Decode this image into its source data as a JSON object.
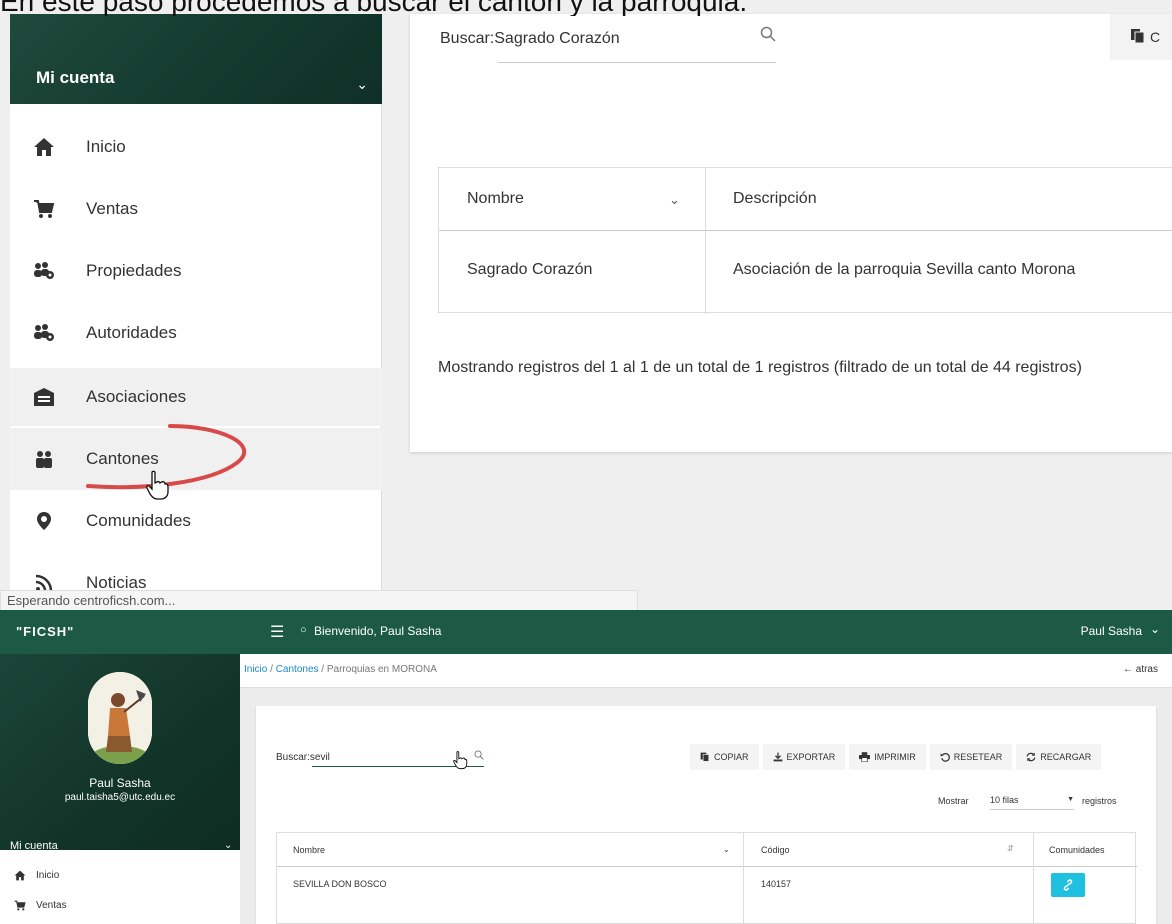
{
  "caption": "En este paso procedemos a buscar el cantón y la parroquia.",
  "zoom": {
    "sidebar": {
      "header_label": "Mi cuenta",
      "items": [
        {
          "label": "Inicio",
          "icon": "home-icon"
        },
        {
          "label": "Ventas",
          "icon": "cart-icon"
        },
        {
          "label": "Propiedades",
          "icon": "users-gear-icon"
        },
        {
          "label": "Autoridades",
          "icon": "users-gear-icon"
        },
        {
          "label": "Asociaciones",
          "icon": "warehouse-icon"
        },
        {
          "label": "Cantones",
          "icon": "map-people-icon"
        },
        {
          "label": "Comunidades",
          "icon": "map-pin-icon"
        },
        {
          "label": "Noticias",
          "icon": "rss-icon"
        }
      ]
    },
    "search_value": "Buscar:Sagrado Corazón",
    "copy_label": "C",
    "table": {
      "headers": [
        "Nombre",
        "Descripción"
      ],
      "rows": [
        [
          "Sagrado Corazón",
          "Asociación de la parroquia Sevilla canto Morona"
        ]
      ]
    },
    "info_text": "Mostrando registros del 1 al 1 de un total de 1 registros (filtrado de un total de 44 registros)",
    "status_text": "Esperando centroficsh.com..."
  },
  "app": {
    "brand": "\"FICSH\"",
    "welcome": "Bienvenido, Paul Sasha",
    "user_menu": "Paul Sasha",
    "profile": {
      "name": "Paul Sasha",
      "email": "paul.taisha5@utc.edu.ec"
    },
    "menu_label": "Mi cuenta",
    "side_items": [
      {
        "label": "Inicio",
        "icon": "home-icon"
      },
      {
        "label": "Ventas",
        "icon": "cart-icon"
      }
    ],
    "breadcrumb": {
      "home": "Inicio",
      "sep1": "/",
      "section": "Cantones",
      "sep2": "/",
      "current": "Parroquias en MORONA"
    },
    "back_label": "atras",
    "search_value": "Buscar:sevil",
    "toolbar": [
      "COPIAR",
      "EXPORTAR",
      "IMPRIMIR",
      "RESETEAR",
      "RECARGAR"
    ],
    "page_size": {
      "prefix": "Mostrar",
      "value": "10 filas",
      "suffix": "registros"
    },
    "table": {
      "headers": [
        "Nombre",
        "Código",
        "Comunidades"
      ],
      "rows": [
        [
          "SEVILLA DON BOSCO",
          "140157"
        ]
      ]
    },
    "colors": {
      "brand_green": "#1d5a46",
      "link_blue": "#1a8ac8",
      "action_cyan": "#20c0e0",
      "annotation_red": "#d84a4a"
    }
  }
}
